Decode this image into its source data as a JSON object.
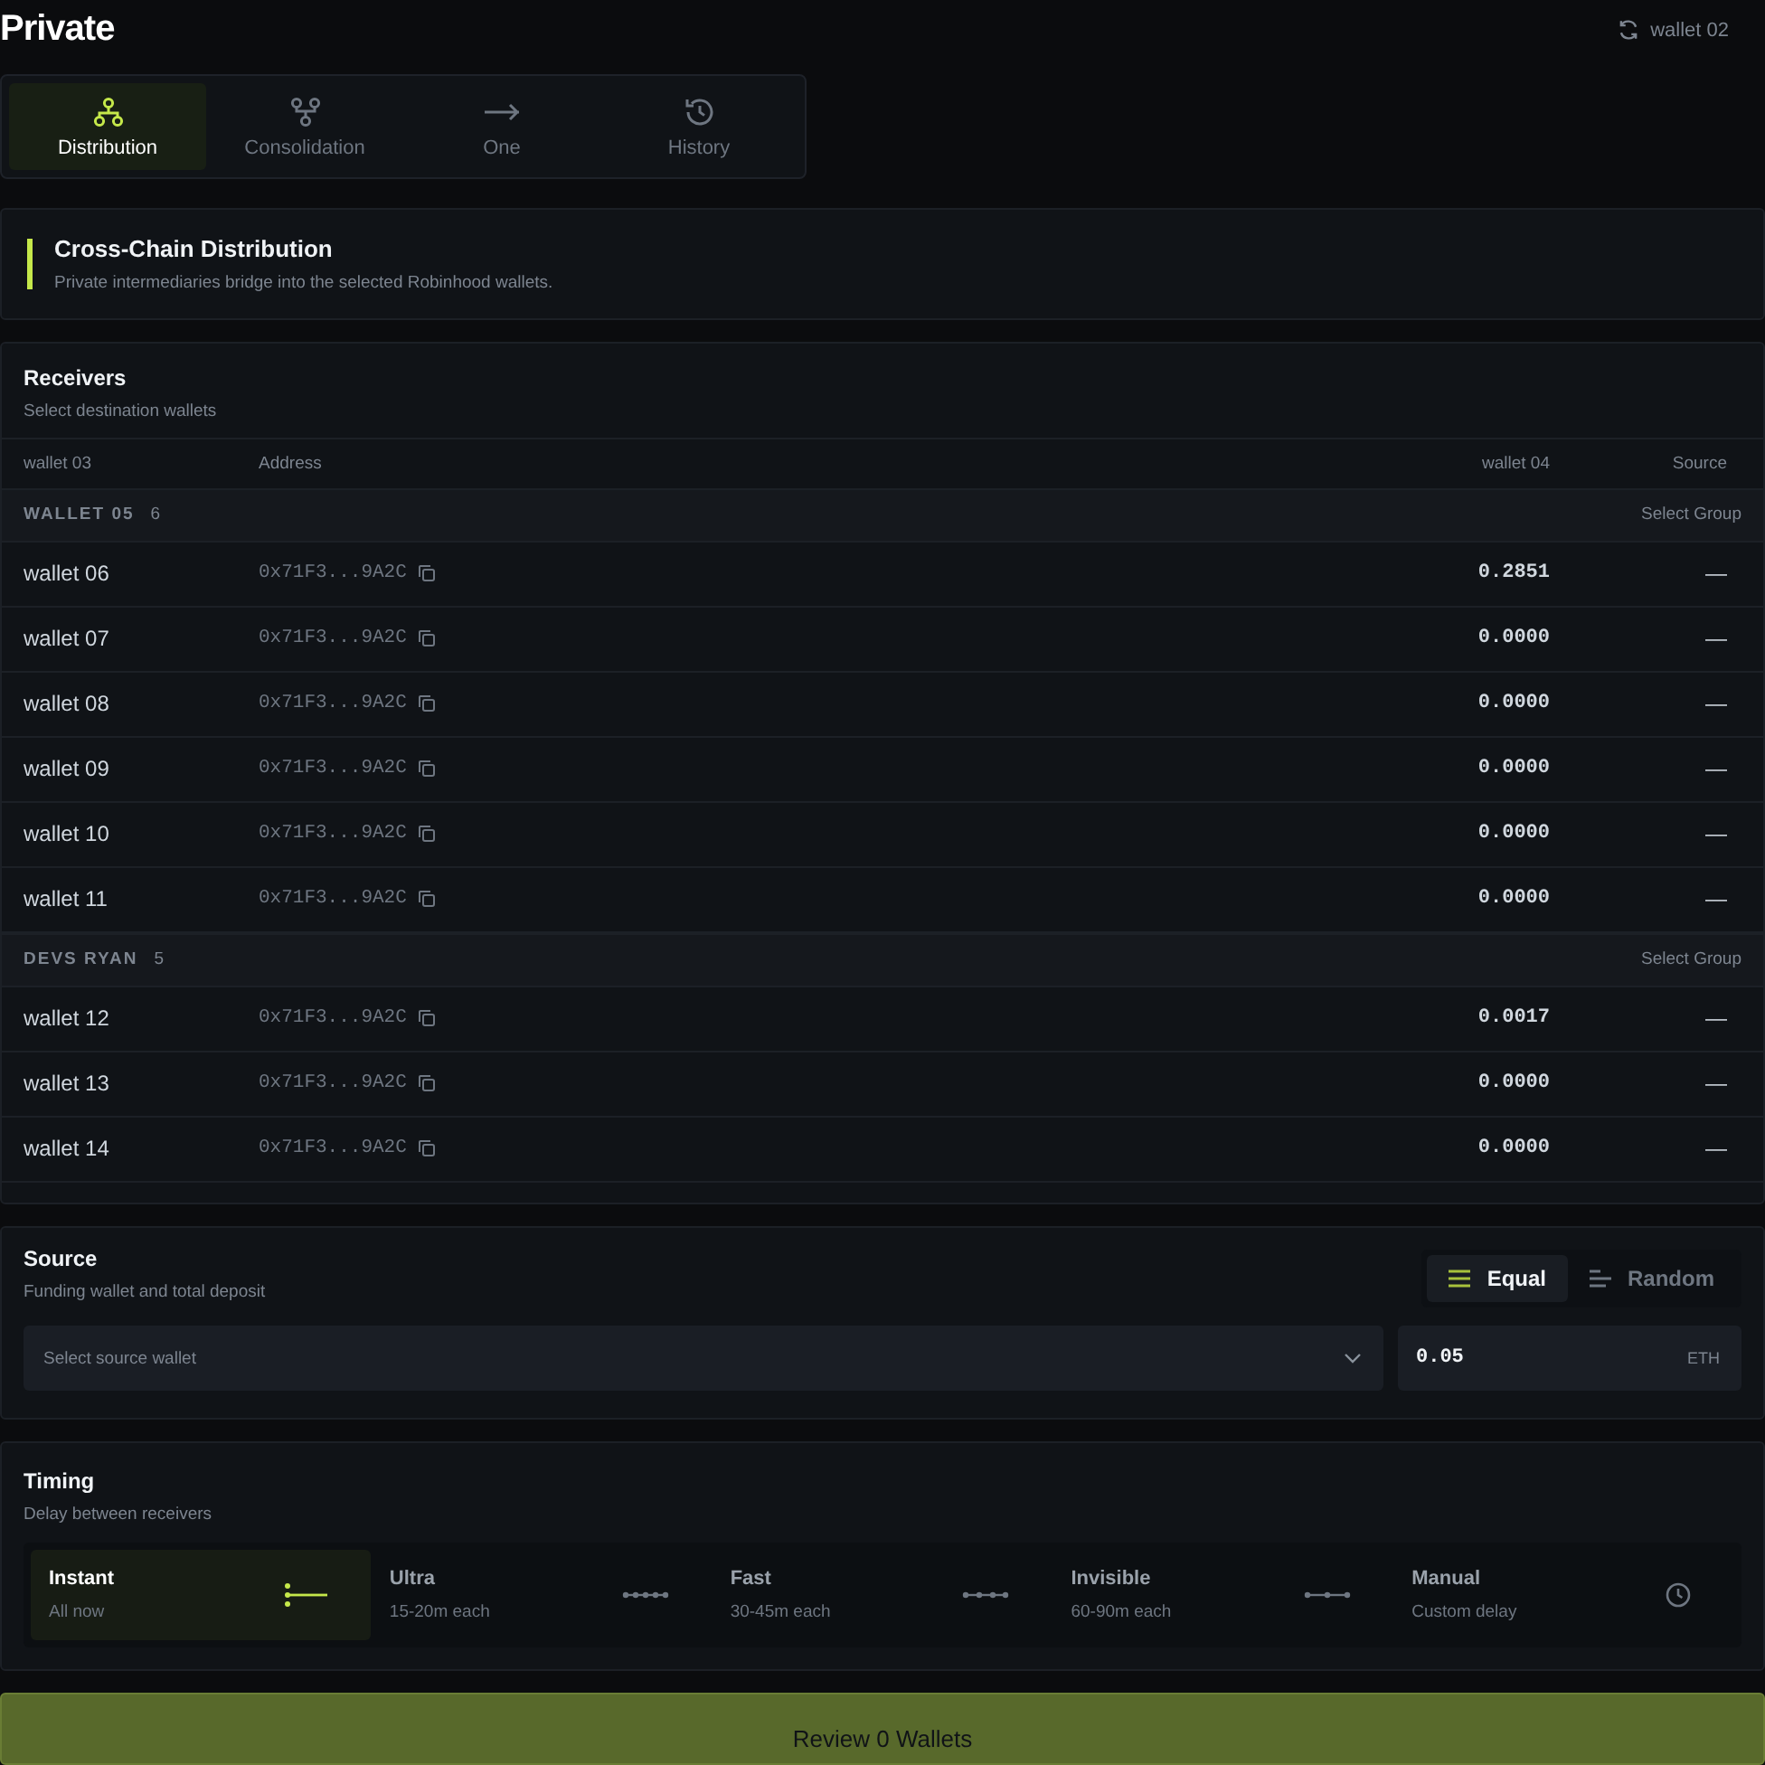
{
  "title": "Private",
  "wallet_badge": "wallet 02",
  "tabs": [
    {
      "label": "Distribution",
      "selected": true
    },
    {
      "label": "Consolidation",
      "selected": false
    },
    {
      "label": "One",
      "selected": false
    },
    {
      "label": "History",
      "selected": false
    }
  ],
  "banner": {
    "title": "Cross-Chain Distribution",
    "text": "Private intermediaries bridge into the selected Robinhood wallets."
  },
  "receivers": {
    "title": "Receivers",
    "subtitle": "Select destination wallets",
    "columns": [
      "wallet 03",
      "Address",
      "wallet 04",
      "Source"
    ],
    "groups": [
      {
        "name": "WALLET 05",
        "count": "6",
        "action": "Select Group",
        "rows": [
          {
            "name": "wallet 06",
            "address": "0x71F3...9A2C",
            "amount": "0.2851",
            "source": "—"
          },
          {
            "name": "wallet 07",
            "address": "0x71F3...9A2C",
            "amount": "0.0000",
            "source": "—"
          },
          {
            "name": "wallet 08",
            "address": "0x71F3...9A2C",
            "amount": "0.0000",
            "source": "—"
          },
          {
            "name": "wallet 09",
            "address": "0x71F3...9A2C",
            "amount": "0.0000",
            "source": "—"
          },
          {
            "name": "wallet 10",
            "address": "0x71F3...9A2C",
            "amount": "0.0000",
            "source": "—"
          },
          {
            "name": "wallet 11",
            "address": "0x71F3...9A2C",
            "amount": "0.0000",
            "source": "—"
          }
        ]
      },
      {
        "name": "DEVS RYAN",
        "count": "5",
        "action": "Select Group",
        "rows": [
          {
            "name": "wallet 12",
            "address": "0x71F3...9A2C",
            "amount": "0.0017",
            "source": "—"
          },
          {
            "name": "wallet 13",
            "address": "0x71F3...9A2C",
            "amount": "0.0000",
            "source": "—"
          },
          {
            "name": "wallet 14",
            "address": "0x71F3...9A2C",
            "amount": "0.0000",
            "source": "—"
          }
        ]
      }
    ]
  },
  "source": {
    "title": "Source",
    "subtitle": "Funding wallet and total deposit",
    "modes": [
      {
        "label": "Equal",
        "selected": true
      },
      {
        "label": "Random",
        "selected": false
      }
    ],
    "wallet_select": {
      "placeholder": "Select source wallet"
    },
    "amount": {
      "value": "0.05",
      "unit": "ETH"
    }
  },
  "timing": {
    "title": "Timing",
    "subtitle": "Delay between receivers",
    "options": [
      {
        "label": "Instant",
        "detail": "All now",
        "selected": true
      },
      {
        "label": "Ultra",
        "detail": "15-20m each",
        "selected": false
      },
      {
        "label": "Fast",
        "detail": "30-45m each",
        "selected": false
      },
      {
        "label": "Invisible",
        "detail": "60-90m each",
        "selected": false
      },
      {
        "label": "Manual",
        "detail": "Custom delay",
        "selected": false
      }
    ]
  },
  "review_button": "Review 0 Wallets"
}
